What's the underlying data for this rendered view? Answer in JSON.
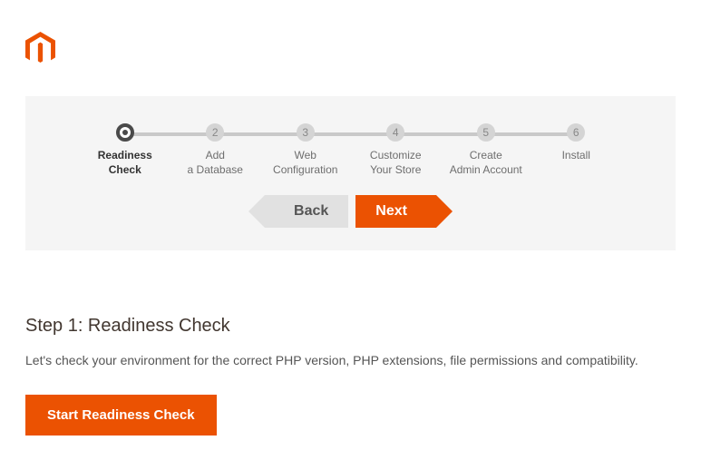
{
  "steps": [
    {
      "num": "",
      "label": "Readiness\nCheck",
      "active": true
    },
    {
      "num": "2",
      "label": "Add\na Database",
      "active": false
    },
    {
      "num": "3",
      "label": "Web\nConfiguration",
      "active": false
    },
    {
      "num": "4",
      "label": "Customize\nYour Store",
      "active": false
    },
    {
      "num": "5",
      "label": "Create\nAdmin Account",
      "active": false
    },
    {
      "num": "6",
      "label": "Install",
      "active": false
    }
  ],
  "nav": {
    "back_label": "Back",
    "next_label": "Next"
  },
  "page": {
    "title": "Step 1: Readiness Check",
    "description": "Let's check your environment for the correct PHP version, PHP extensions, file permissions and compatibility.",
    "cta_label": "Start Readiness Check"
  }
}
